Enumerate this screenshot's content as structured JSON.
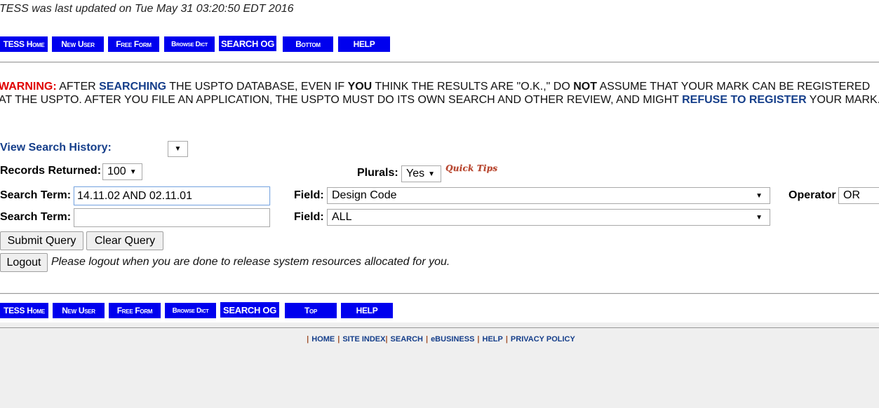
{
  "header": {
    "last_updated": "TESS was last updated on Tue May 31 03:20:50 EDT 2016"
  },
  "top_nav": [
    {
      "label": "TESS Home"
    },
    {
      "label": "New User"
    },
    {
      "label": "Free Form"
    },
    {
      "label": "Browse Dict"
    },
    {
      "label": "SEARCH OG"
    },
    {
      "label": "Bottom"
    },
    {
      "label": "HELP"
    }
  ],
  "bottom_nav": [
    {
      "label": "TESS Home"
    },
    {
      "label": "New User"
    },
    {
      "label": "Free Form"
    },
    {
      "label": "Browse Dict"
    },
    {
      "label": "SEARCH OG"
    },
    {
      "label": "Top"
    },
    {
      "label": "HELP"
    }
  ],
  "warning": {
    "prefix": "WARNING:",
    "t1": " AFTER ",
    "searching": "SEARCHING",
    "t2": " THE USPTO DATABASE, EVEN IF ",
    "you": "YOU",
    "t3": " THINK THE RESULTS ARE \"O.K.,\" DO ",
    "not": "NOT",
    "t4": " ASSUME THAT YOUR MARK CAN BE REGISTERED AT THE USPTO. AFTER YOU FILE AN APPLICATION, THE USPTO MUST DO ITS OWN SEARCH AND OTHER REVIEW, AND MIGHT ",
    "refuse": "REFUSE TO REGISTER",
    "t5": " YOUR MARK."
  },
  "form": {
    "view_history_label": "View Search History:",
    "view_history_value": "",
    "records_label": "Records Returned:",
    "records_value": "100",
    "plurals_label": "Plurals:",
    "plurals_value": "Yes",
    "quick_tips": "Quick Tips",
    "search_term_label": "Search Term:",
    "search_term_1": "14.11.02 AND 02.11.01",
    "search_term_2": "",
    "field_label": "Field:",
    "field_1": "Design Code",
    "field_2": "ALL",
    "operator_label": "Operator",
    "operator_value": "OR",
    "submit": "Submit Query",
    "clear": "Clear Query",
    "logout": "Logout",
    "logout_note": "Please logout when you are done to release system resources allocated for you."
  },
  "footer": {
    "links": [
      "HOME",
      "SITE INDEX",
      "SEARCH",
      "eBUSINESS",
      "HELP",
      "PRIVACY POLICY"
    ]
  },
  "icons": {
    "caret": "▼"
  }
}
